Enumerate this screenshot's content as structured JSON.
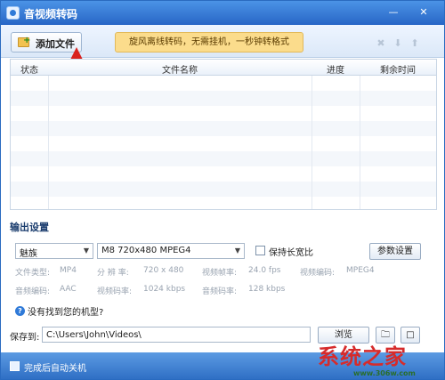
{
  "window": {
    "title": "音视频转码"
  },
  "toolbar": {
    "add_file_label": "添加文件",
    "promo_text": "旋风离线转码，无需挂机，一秒钟转格式"
  },
  "table": {
    "headers": {
      "status": "状态",
      "filename": "文件名称",
      "progress": "进度",
      "remaining": "剩余时间"
    },
    "rows": []
  },
  "output": {
    "section_title": "输出设置",
    "device": "魅族",
    "format": "M8 720x480 MPEG4",
    "keep_ratio_label": "保持长宽比",
    "keep_ratio_checked": false,
    "params_button": "参数设置",
    "info": [
      {
        "label": "文件类型:",
        "value": "MP4"
      },
      {
        "label": "分 辨 率:",
        "value": "720 x 480"
      },
      {
        "label": "视频帧率:",
        "value": "24.0 fps"
      },
      {
        "label": "视频编码:",
        "value": "MPEG4"
      },
      {
        "label": "音频编码:",
        "value": "AAC"
      },
      {
        "label": "视频码率:",
        "value": "1024 kbps"
      },
      {
        "label": "音频码率:",
        "value": "128 kbps"
      }
    ],
    "help_text": "没有找到您的机型?"
  },
  "save": {
    "label": "保存到:",
    "path": "C:\\Users\\John\\Videos\\",
    "browse_button": "浏览"
  },
  "footer": {
    "shutdown_label": "完成后自动关机",
    "shutdown_checked": false
  },
  "watermark": {
    "text": "系统之家",
    "sub": "www.306w.com"
  }
}
